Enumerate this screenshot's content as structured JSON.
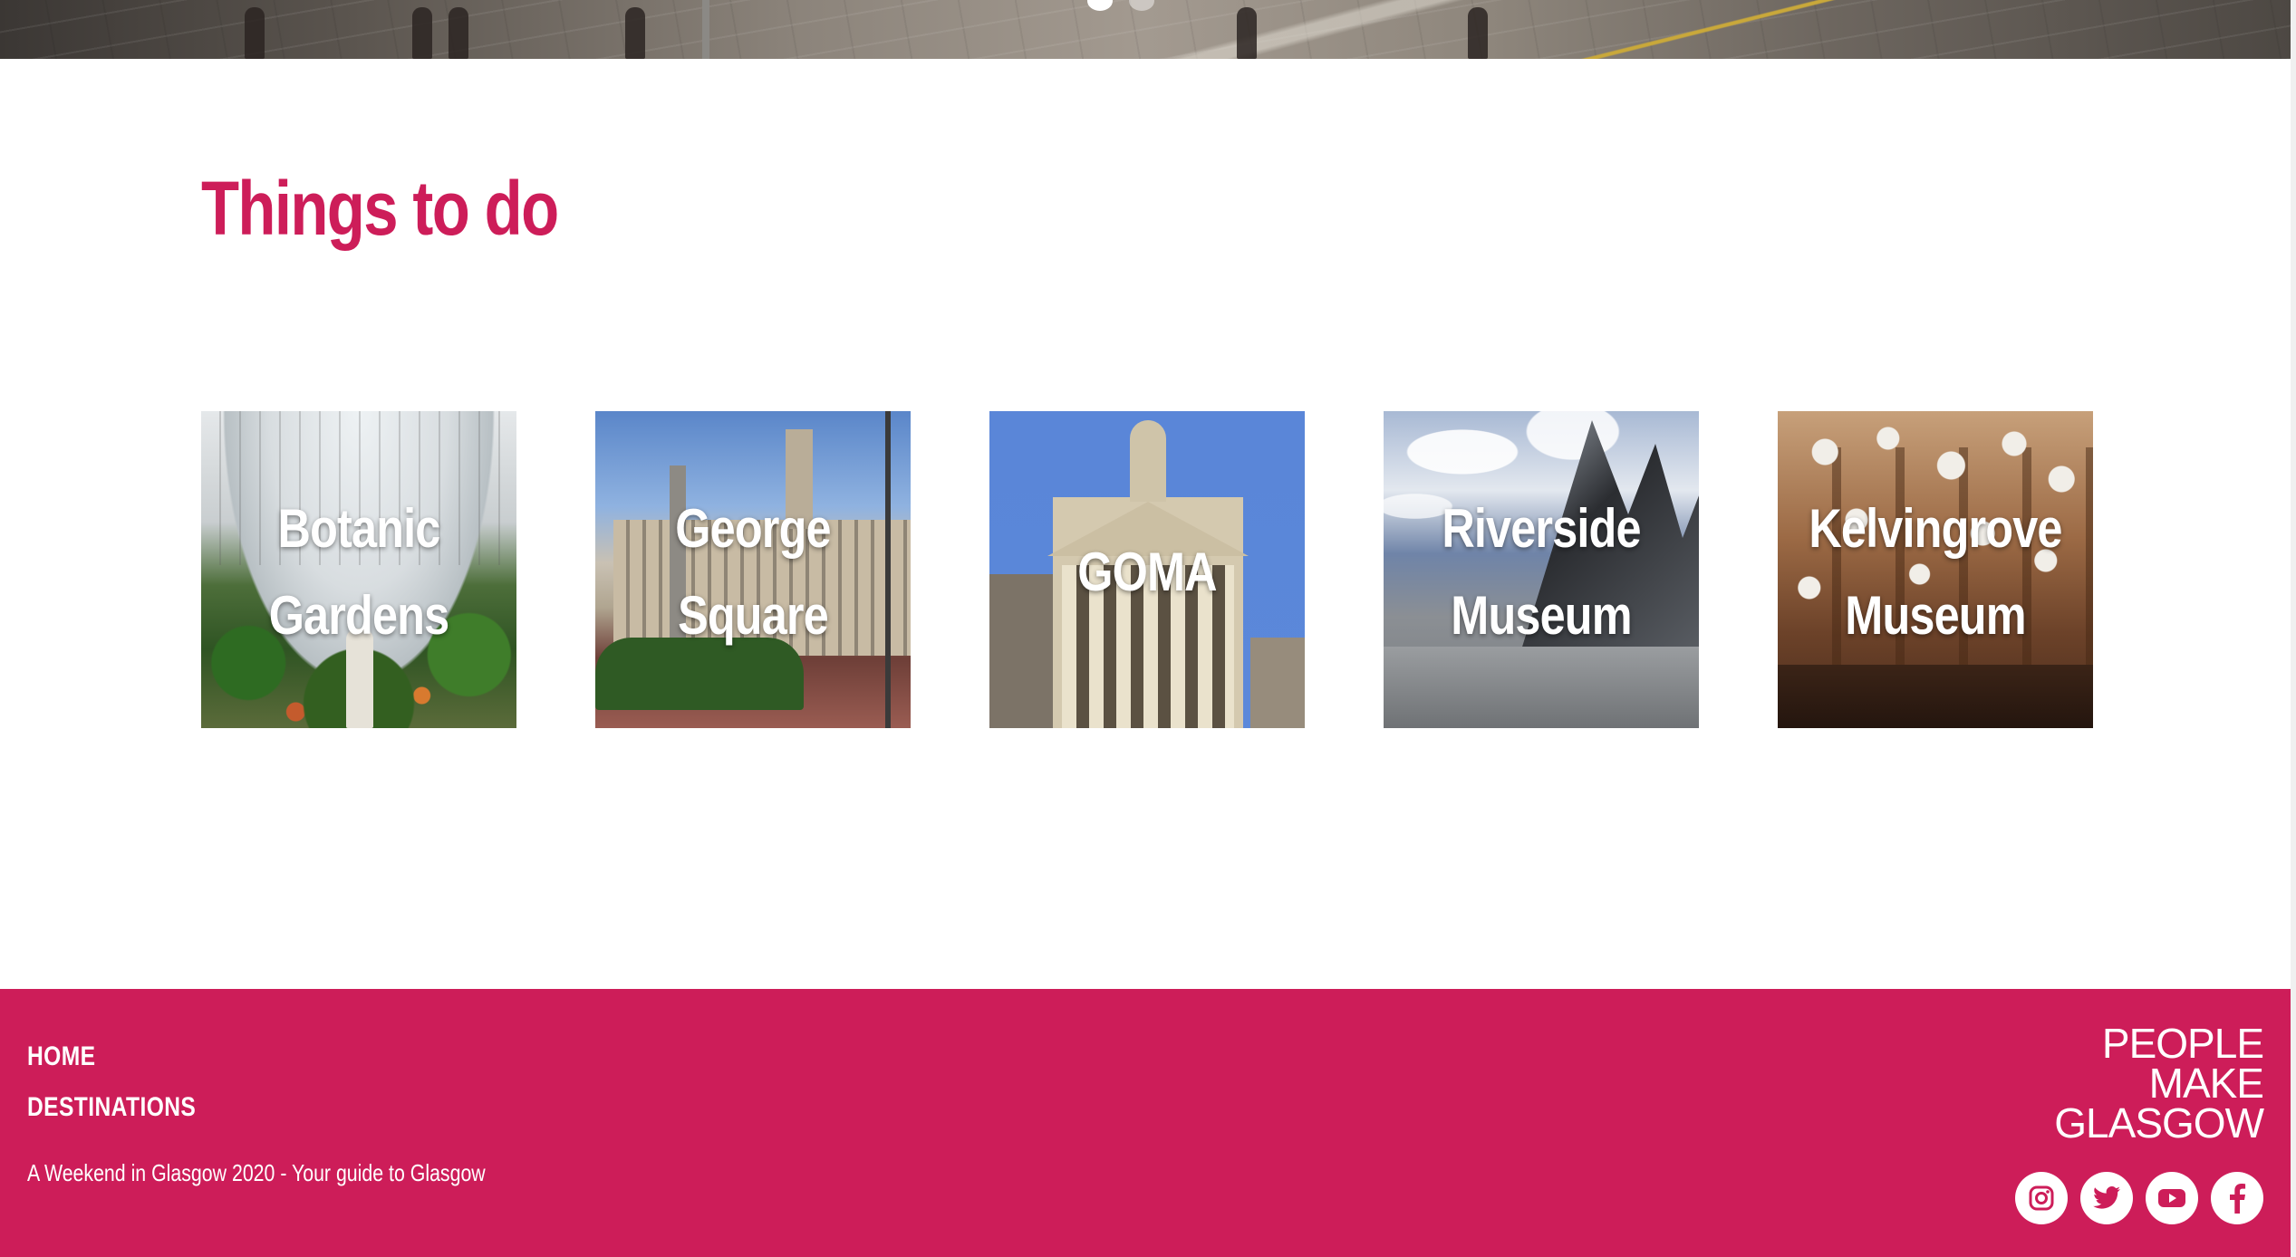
{
  "hero": {
    "carousel_dots": 2,
    "active_dot": 1
  },
  "main": {
    "section_title": "Things to do",
    "cards": [
      {
        "id": "botanic",
        "label_line1": "Botanic",
        "label_line2": "Gardens"
      },
      {
        "id": "george",
        "label_line1": "George",
        "label_line2": "Square"
      },
      {
        "id": "goma",
        "label_line1": "GOMA",
        "label_line2": ""
      },
      {
        "id": "riverside",
        "label_line1": "Riverside",
        "label_line2": "Museum"
      },
      {
        "id": "kelvingrove",
        "label_line1": "Kelvingrove",
        "label_line2": "Museum"
      }
    ]
  },
  "footer": {
    "nav": [
      {
        "label": "HOME"
      },
      {
        "label": "DESTINATIONS"
      }
    ],
    "tagline": "A Weekend in Glasgow 2020 - Your guide to Glasgow",
    "logo_lines": [
      "PEOPLE",
      "MAKE",
      "GLASGOW"
    ],
    "socials": [
      {
        "icon": "instagram-icon"
      },
      {
        "icon": "twitter-icon"
      },
      {
        "icon": "youtube-icon"
      },
      {
        "icon": "facebook-icon"
      }
    ]
  },
  "colors": {
    "brand": "#cd1d59",
    "text_on_brand": "#ffffff"
  }
}
